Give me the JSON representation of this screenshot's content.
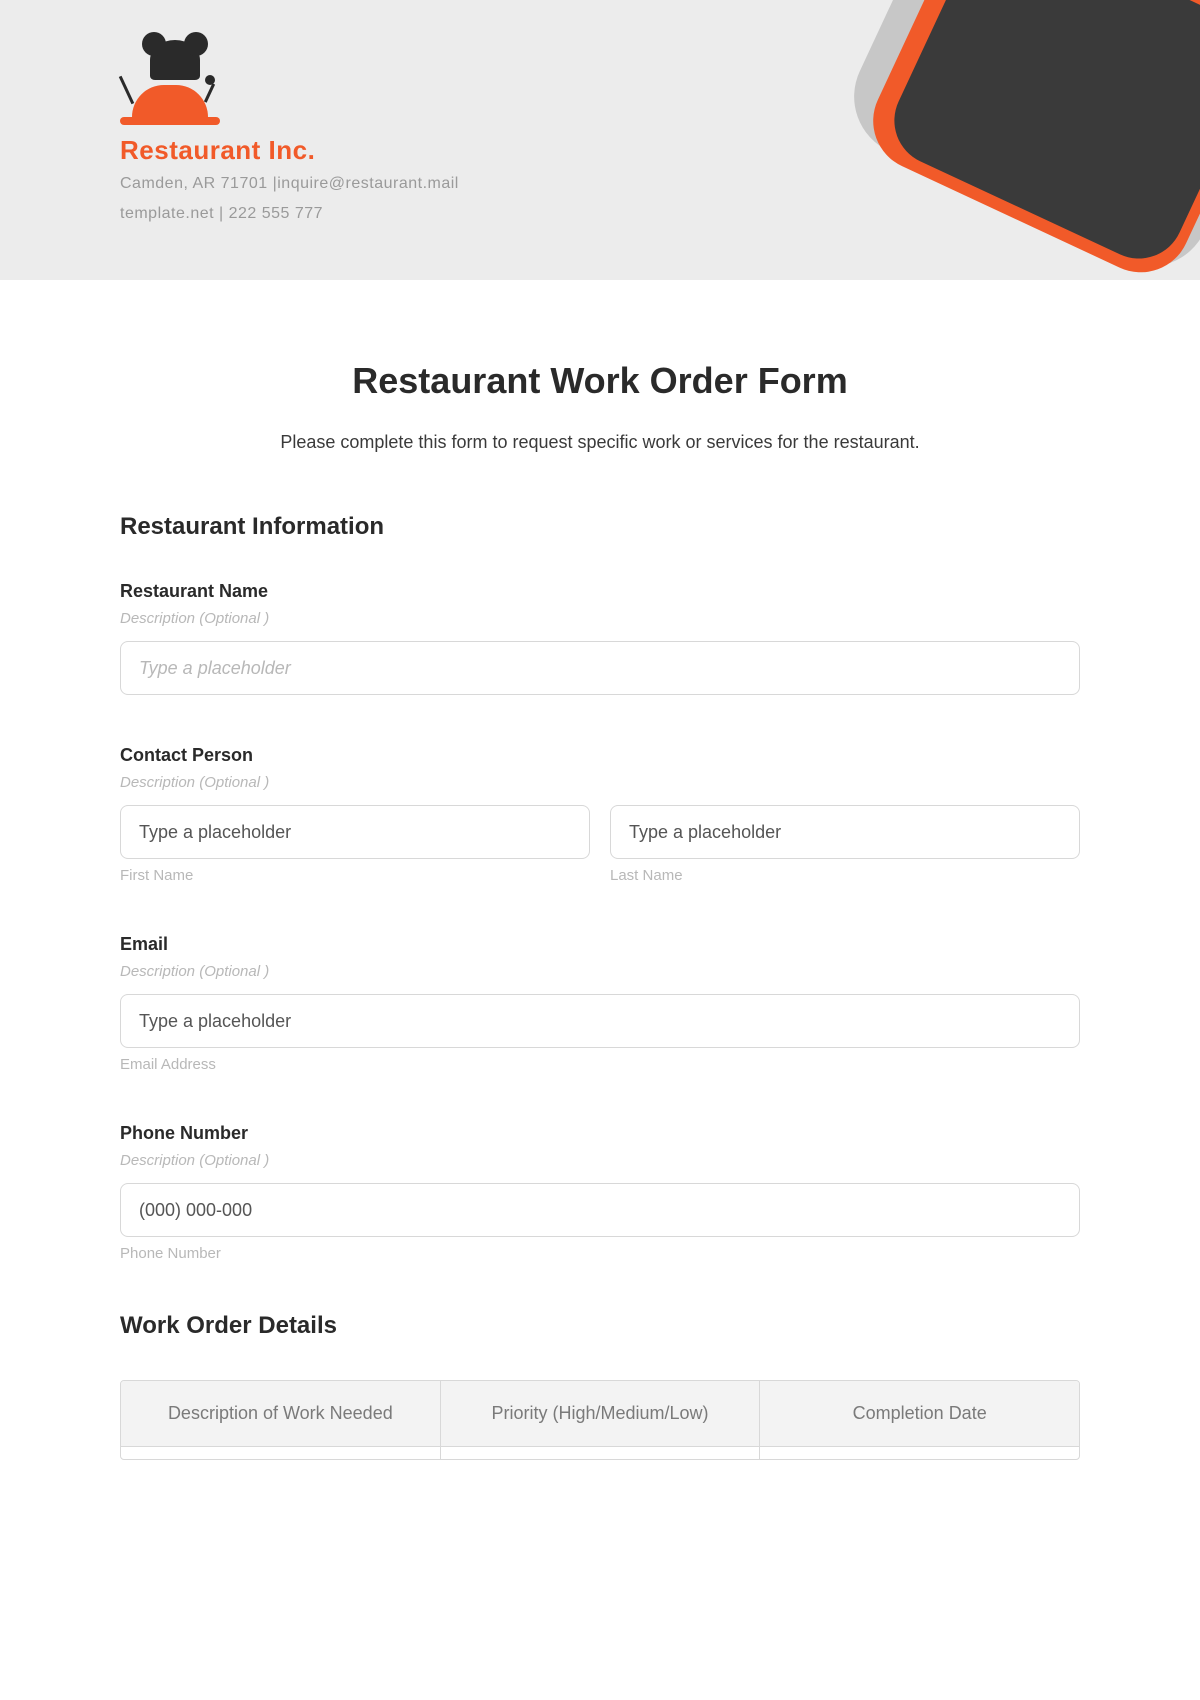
{
  "brand": {
    "name": "Restaurant Inc.",
    "address_line": "Camden, AR 71701 |inquire@restaurant.mail",
    "contact_line": "template.net | 222 555 777"
  },
  "form": {
    "title": "Restaurant Work Order Form",
    "intro": "Please complete this form to request specific work or services for the restaurant."
  },
  "section1": {
    "heading": "Restaurant Information",
    "restaurant_name": {
      "label": "Restaurant Name",
      "desc": "Description (Optional )",
      "placeholder": "Type a placeholder"
    },
    "contact_person": {
      "label": "Contact Person",
      "desc": "Description (Optional )",
      "first_placeholder": "Type a placeholder",
      "last_placeholder": "Type a placeholder",
      "first_sub": "First Name",
      "last_sub": "Last Name"
    },
    "email": {
      "label": "Email",
      "desc": "Description (Optional )",
      "placeholder": "Type a placeholder",
      "sub": "Email Address"
    },
    "phone": {
      "label": "Phone Number",
      "desc": "Description (Optional )",
      "placeholder": "(000) 000-000",
      "sub": "Phone Number"
    }
  },
  "section2": {
    "heading": "Work Order Details",
    "columns": {
      "c1": "Description of Work Needed",
      "c2": "Priority (High/Medium/Low)",
      "c3": "Completion Date"
    }
  }
}
